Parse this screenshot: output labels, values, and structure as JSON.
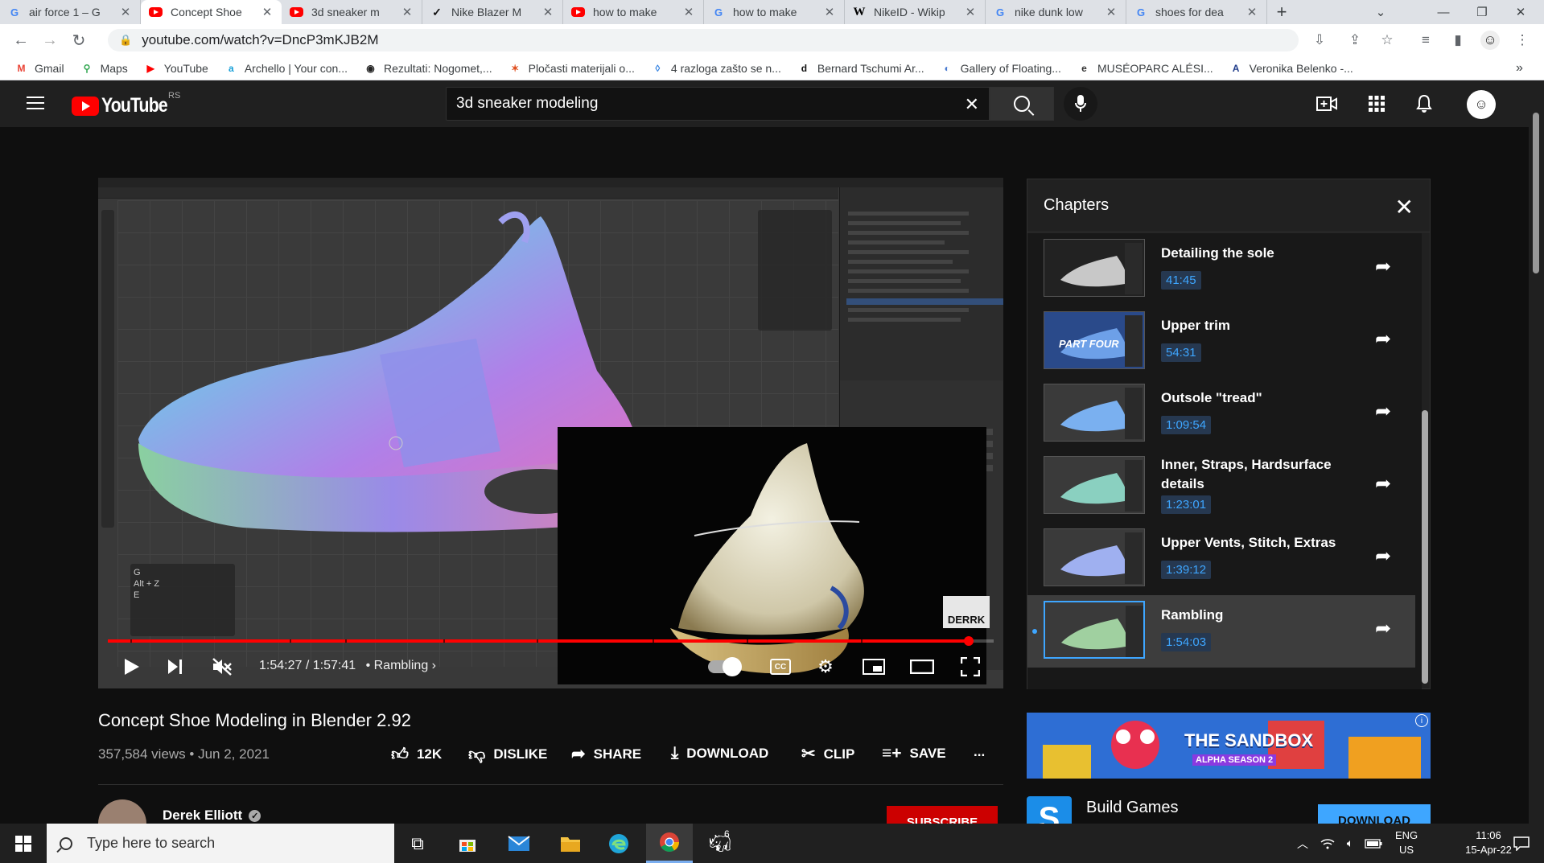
{
  "browser": {
    "tabs": [
      {
        "title": "air force 1 – G",
        "favicon": "google",
        "active": false
      },
      {
        "title": "Concept Shoe",
        "favicon": "youtube",
        "active": true
      },
      {
        "title": "3d sneaker m",
        "favicon": "youtube",
        "active": false
      },
      {
        "title": "Nike Blazer M",
        "favicon": "nike",
        "active": false
      },
      {
        "title": "how to make",
        "favicon": "youtube",
        "active": false
      },
      {
        "title": "how to make",
        "favicon": "google",
        "active": false
      },
      {
        "title": "NikeID - Wikip",
        "favicon": "wikipedia",
        "active": false
      },
      {
        "title": "nike dunk low",
        "favicon": "google",
        "active": false
      },
      {
        "title": "shoes for dea",
        "favicon": "google",
        "active": false
      }
    ],
    "url": "youtube.com/watch?v=DncP3mKJB2M",
    "bookmarks": [
      {
        "label": "Gmail",
        "color": "#ea4335",
        "glyph": "M"
      },
      {
        "label": "Maps",
        "color": "#34a853",
        "glyph": "⚲"
      },
      {
        "label": "YouTube",
        "color": "#ff0000",
        "glyph": "▶"
      },
      {
        "label": "Archello | Your con...",
        "color": "#18a0d8",
        "glyph": "a"
      },
      {
        "label": "Rezultati: Nogomet,...",
        "color": "#222222",
        "glyph": "◉"
      },
      {
        "label": "Pločasti materijali o...",
        "color": "#e05020",
        "glyph": "✶"
      },
      {
        "label": "4 razloga zašto se n...",
        "color": "#2a7de1",
        "glyph": "◊"
      },
      {
        "label": "Bernard Tschumi Ar...",
        "color": "#111111",
        "glyph": "d"
      },
      {
        "label": "Gallery of Floating...",
        "color": "#4a7bd0",
        "glyph": "◐"
      },
      {
        "label": "MUSÉOPARC ALÉSI...",
        "color": "#333333",
        "glyph": "e"
      },
      {
        "label": "Veronika Belenko -...",
        "color": "#1f3c8a",
        "glyph": "A"
      }
    ],
    "more_bookmarks": "»"
  },
  "youtube": {
    "logo_text": "YouTube",
    "region": "RS",
    "search_value": "3d sneaker modeling",
    "search_placeholder": "Search"
  },
  "player": {
    "current_time": "1:54:27",
    "duration": "1:57:41",
    "current_chapter": "Rambling",
    "progress": 0.972,
    "overlay_label": "DERRK",
    "chapter_markers": [
      0.025,
      0.205,
      0.268,
      0.379,
      0.484,
      0.615,
      0.721,
      0.85,
      0.972
    ]
  },
  "video": {
    "title": "Concept Shoe Modeling in Blender 2.92",
    "views": "357,584 views",
    "date": "Jun 2, 2021",
    "likes": "12K",
    "dislike_label": "DISLIKE",
    "share_label": "SHARE",
    "download_label": "DOWNLOAD",
    "clip_label": "CLIP",
    "save_label": "SAVE",
    "more": "..."
  },
  "channel": {
    "name": "Derek Elliott",
    "subscribe_label": "SUBSCRIBE"
  },
  "chapters_panel": {
    "title": "Chapters",
    "items": [
      {
        "title": "Detailing the sole",
        "time": "41:45",
        "thumb_text": ""
      },
      {
        "title": "Upper trim",
        "time": "54:31",
        "thumb_text": "PART FOUR"
      },
      {
        "title": "Outsole \"tread\"",
        "time": "1:09:54",
        "thumb_text": ""
      },
      {
        "title": "Inner, Straps, Hardsurface details",
        "time": "1:23:01",
        "thumb_text": ""
      },
      {
        "title": "Upper Vents, Stitch, Extras",
        "time": "1:39:12",
        "thumb_text": ""
      },
      {
        "title": "Rambling",
        "time": "1:54:03",
        "thumb_text": ""
      }
    ],
    "active_index": 5
  },
  "ad": {
    "banner_text": "THE SANDBOX",
    "banner_sub": "ALPHA SEASON 2",
    "title": "Build Games",
    "button": "DOWNLOAD",
    "info": "i"
  },
  "taskbar": {
    "search_placeholder": "Type here to search",
    "lang_top": "ENG",
    "lang_bottom": "US",
    "time": "11:06",
    "date": "15-Apr-22",
    "badge": "6"
  },
  "colors": {
    "accent": "#ff0000",
    "link_blue": "#3ea6ff",
    "background": "#0f0f0f"
  }
}
